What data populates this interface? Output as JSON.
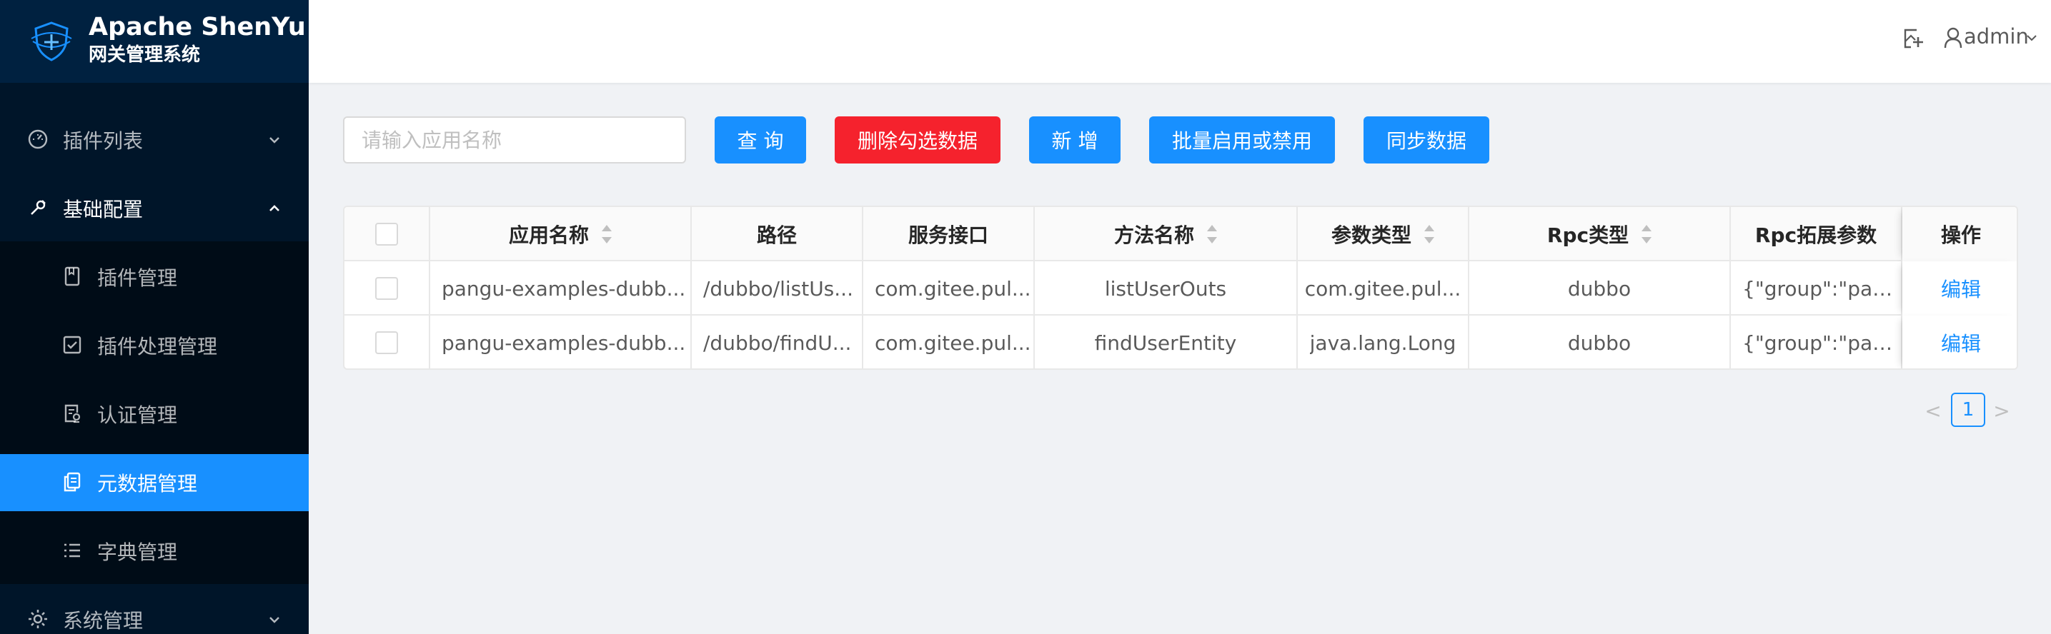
{
  "app": {
    "title": "Apache ShenYu",
    "subtitle": "网关管理系统"
  },
  "sidebar": {
    "items": [
      {
        "label": "插件列表",
        "icon": "dashboard-icon",
        "level": "top",
        "expanded": false
      },
      {
        "label": "基础配置",
        "icon": "tool-icon",
        "level": "top",
        "expanded": true
      },
      {
        "label": "插件管理",
        "icon": "book-icon",
        "level": "sub"
      },
      {
        "label": "插件处理管理",
        "icon": "check-square-icon",
        "level": "sub"
      },
      {
        "label": "认证管理",
        "icon": "audit-icon",
        "level": "sub"
      },
      {
        "label": "元数据管理",
        "icon": "snippets-icon",
        "level": "sub",
        "active": true
      },
      {
        "label": "字典管理",
        "icon": "list-icon",
        "level": "sub"
      },
      {
        "label": "系统管理",
        "icon": "setting-icon",
        "level": "top",
        "expanded": false
      }
    ]
  },
  "header": {
    "username": "admin",
    "icons": [
      "fullscreen-icon",
      "user-icon",
      "chevron-down-icon"
    ]
  },
  "toolbar": {
    "search_placeholder": "请输入应用名称",
    "search_value": "",
    "query_label": "查 询",
    "delete_label": "删除勾选数据",
    "add_label": "新 增",
    "batch_label": "批量启用或禁用",
    "sync_label": "同步数据"
  },
  "table": {
    "columns": [
      "应用名称",
      "路径",
      "服务接口",
      "方法名称",
      "参数类型",
      "Rpc类型",
      "Rpc拓展参数",
      "操作"
    ],
    "sortable": [
      true,
      false,
      false,
      true,
      true,
      true,
      false,
      false
    ],
    "rows": [
      {
        "app_name": "pangu-examples-dubb...",
        "path": "/dubbo/listUs...",
        "service": "com.gitee.pul...",
        "method": "listUserOuts",
        "param_types": "com.gitee.pul...",
        "rpc_type": "dubbo",
        "rpc_ext": "{\"group\":\"pan...",
        "action": "编辑"
      },
      {
        "app_name": "pangu-examples-dubb...",
        "path": "/dubbo/findU...",
        "service": "com.gitee.pul...",
        "method": "findUserEntity",
        "param_types": "java.lang.Long",
        "rpc_type": "dubbo",
        "rpc_ext": "{\"group\":\"pan...",
        "action": "编辑"
      }
    ]
  },
  "pagination": {
    "prev": "<",
    "current": "1",
    "next": ">"
  },
  "colors": {
    "primary": "#1890ff",
    "danger": "#f5222d",
    "sidebar_bg": "#001529",
    "logo_bg": "#002140",
    "submenu_bg": "#000c17",
    "page_bg": "#f0f2f5"
  }
}
